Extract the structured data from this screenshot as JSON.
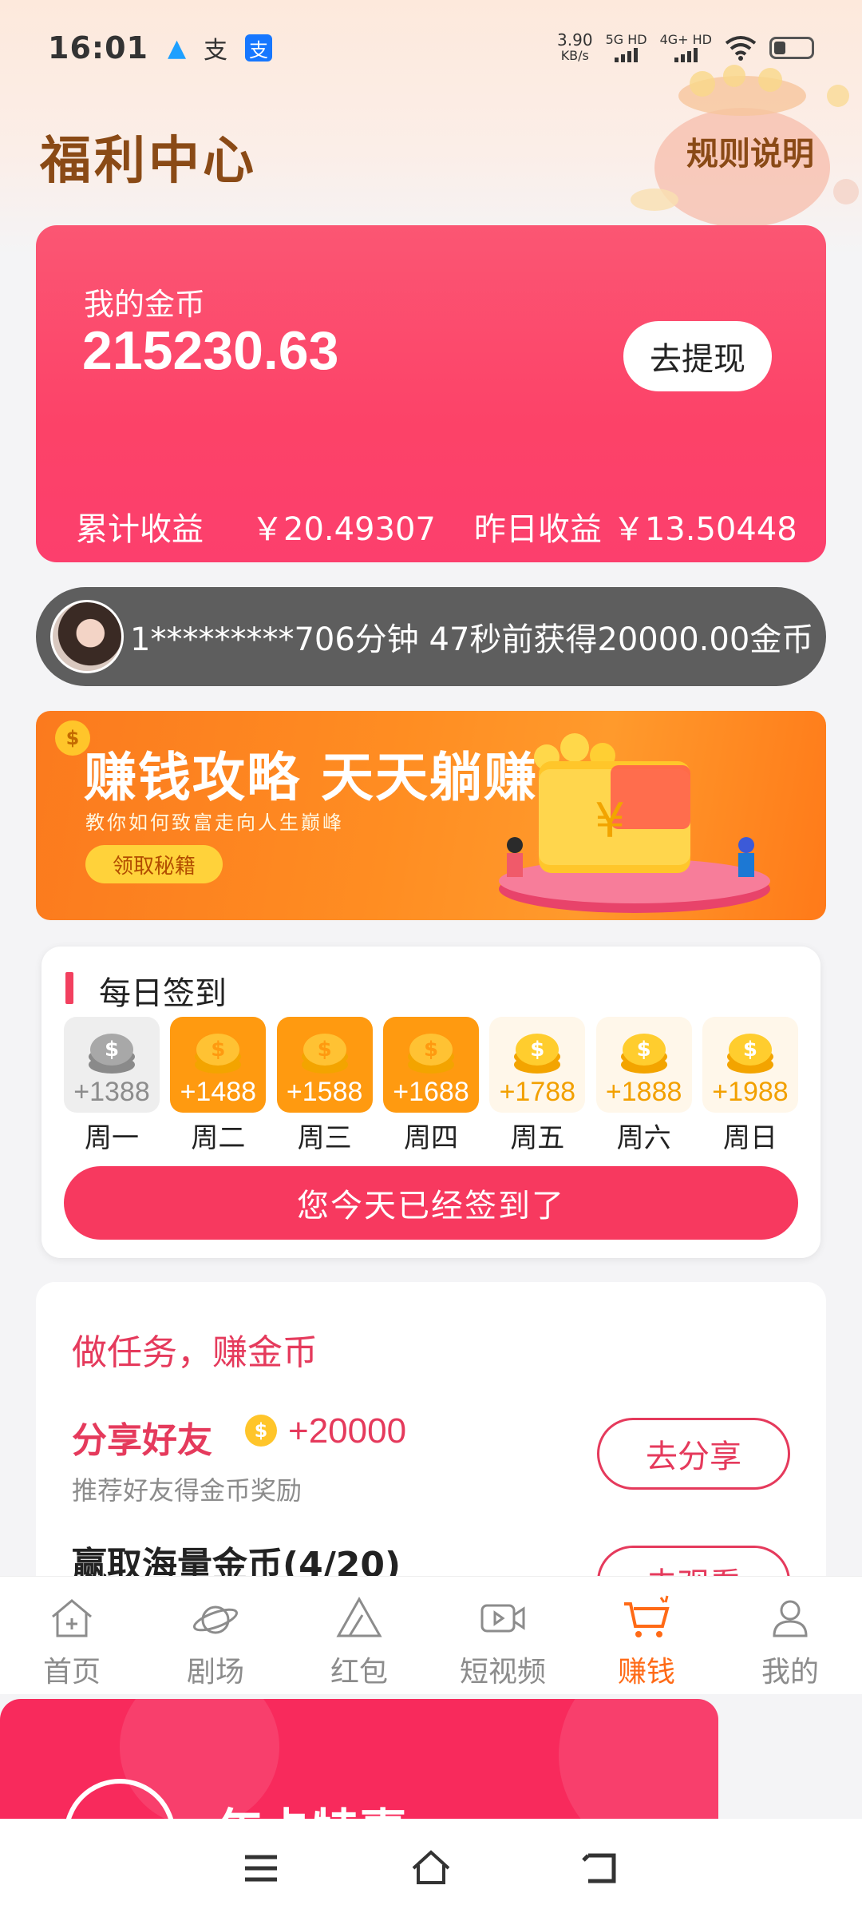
{
  "status_bar": {
    "time": "16:01",
    "net_speed_value": "3.90",
    "net_speed_unit": "KB/s",
    "signal1_label": "5G HD",
    "signal2_label": "4G+ HD"
  },
  "header": {
    "title": "福利中心",
    "rules_link": "规则说明"
  },
  "coin_card": {
    "label": "我的金币",
    "value": "215230.63",
    "withdraw_label": "去提现",
    "total_label": "累计收益",
    "total_value": "￥20.49307",
    "yesterday_label": "昨日收益",
    "yesterday_value": "￥13.50448"
  },
  "ticker": {
    "text": "1*********706分钟 47秒前获得20000.00金币"
  },
  "banner": {
    "title": "赚钱攻略 天天躺赚",
    "subtitle": "教你如何致富走向人生巅峰",
    "button_label": "领取秘籍"
  },
  "checkin": {
    "title": "每日签到",
    "button_label": "您今天已经签到了",
    "days": [
      {
        "name": "周一",
        "amount": "+1388",
        "state": "past"
      },
      {
        "name": "周二",
        "amount": "+1488",
        "state": "done"
      },
      {
        "name": "周三",
        "amount": "+1588",
        "state": "done"
      },
      {
        "name": "周四",
        "amount": "+1688",
        "state": "done"
      },
      {
        "name": "周五",
        "amount": "+1788",
        "state": "future"
      },
      {
        "name": "周六",
        "amount": "+1888",
        "state": "future"
      },
      {
        "name": "周日",
        "amount": "+1988",
        "state": "future"
      }
    ]
  },
  "tasks": {
    "title": "做任务，赚金币",
    "items": [
      {
        "name": "分享好友",
        "reward": "+20000",
        "desc": "推荐好友得金币奖励",
        "button": "去分享"
      },
      {
        "name": "赢取海量金币(4/20)",
        "button": "去观看"
      }
    ]
  },
  "bottom_nav": {
    "items": [
      {
        "label": "首页",
        "icon": "home-icon"
      },
      {
        "label": "剧场",
        "icon": "planet-icon"
      },
      {
        "label": "红包",
        "icon": "red-packet-icon"
      },
      {
        "label": "短视频",
        "icon": "video-icon"
      },
      {
        "label": "赚钱",
        "icon": "cart-icon",
        "active": true
      },
      {
        "label": "我的",
        "icon": "profile-icon"
      }
    ],
    "active_color": "#ff6a16",
    "inactive_color": "#8c8c8c"
  },
  "promo": {
    "text": "年卡特惠"
  },
  "colors": {
    "accent_pink": "#f7395f",
    "brown_title": "#8a4a16",
    "orange": "#ff9a10"
  }
}
